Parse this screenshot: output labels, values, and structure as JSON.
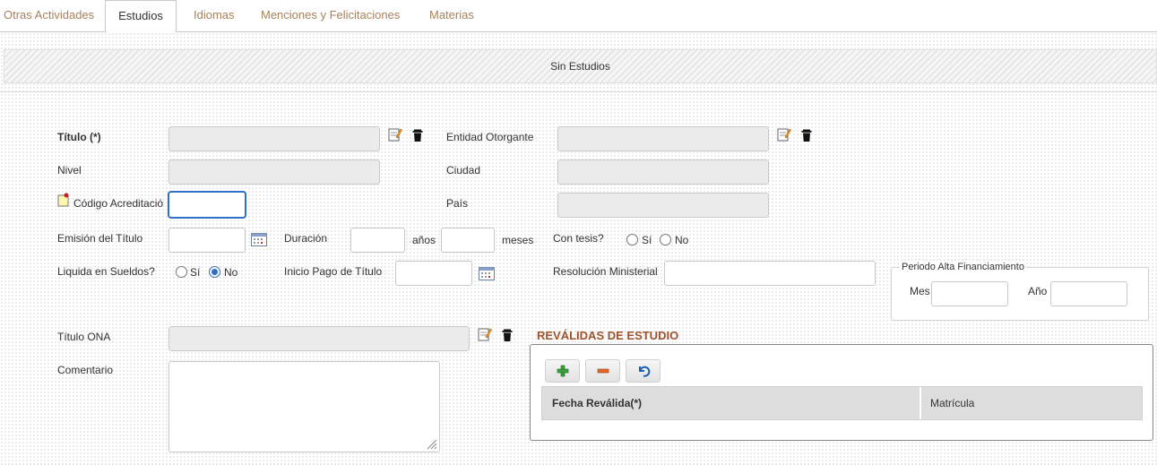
{
  "tabs": [
    {
      "label": "Otras Actividades",
      "active": false
    },
    {
      "label": "Estudios",
      "active": true
    },
    {
      "label": "Idiomas",
      "active": false
    },
    {
      "label": "Menciones y Felicitaciones",
      "active": false
    },
    {
      "label": "Materias",
      "active": false
    }
  ],
  "banner": {
    "text": "Sin Estudios"
  },
  "form": {
    "titulo_label": "Título (*)",
    "nivel_label": "Nivel",
    "codigo_label": "Código Acreditació",
    "emision_label": "Emisión del Título",
    "duracion_label": "Duración",
    "anios_label": "años",
    "meses_label": "meses",
    "contesis_label": "Con tesis?",
    "liquida_label": "Liquida en Sueldos?",
    "inicio_pago_label": "Inicio Pago de Título",
    "entidad_label": "Entidad Otorgante",
    "ciudad_label": "Ciudad",
    "pais_label": "País",
    "resolucion_label": "Resolución Ministerial",
    "titulo_ona_label": "Título ONA",
    "comentario_label": "Comentario",
    "si_label": "Sí",
    "no_label": "No",
    "contesis_value": "none",
    "liquida_value": "No"
  },
  "periodo": {
    "legend": "Periodo Alta Financiamiento",
    "mes_label": "Mes",
    "anio_label": "Año"
  },
  "revalidas": {
    "title": "REVÁLIDAS DE ESTUDIO",
    "columns": [
      "Fecha Reválida(*)",
      "Matrícula"
    ]
  },
  "colors": {
    "tab_text": "#a7835c",
    "section_title": "#a0522d",
    "focus_border": "#2f6fc6"
  }
}
